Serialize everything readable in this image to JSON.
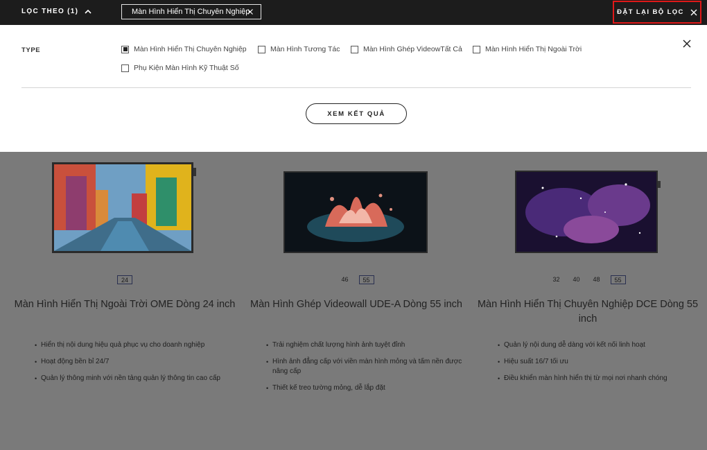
{
  "header": {
    "filter_toggle_label": "LỌC THEO (1)",
    "active_chip_label": "Màn Hình Hiển Thị Chuyên Nghiệp",
    "reset_label": "ĐẶT LẠI BỘ LỌC"
  },
  "filter_panel": {
    "type_label": "TYPE",
    "options": [
      {
        "label": "Màn Hình Hiển Thị Chuyên Nghiệp",
        "checked": true
      },
      {
        "label": "Màn Hình Tương Tác",
        "checked": false
      },
      {
        "label": "Màn Hình Ghép VideowTất Cả",
        "checked": false
      },
      {
        "label": "Màn Hình Hiển Thị Ngoài Trời",
        "checked": false
      },
      {
        "label": "Phụ Kiện Màn Hình Kỹ Thuật Số",
        "checked": false
      }
    ],
    "results_button_label": "XEM KẾT QUẢ"
  },
  "products": [
    {
      "sizes": [
        {
          "label": "24",
          "active": true
        }
      ],
      "title": "Màn Hình Hiển Thị Ngoài Trời OME Dòng 24 inch",
      "features": [
        "Hiển thị nội dung hiệu quả phục vụ cho doanh nghiệp",
        "Hoạt động bền bỉ 24/7",
        "Quản lý thông minh với nền tảng quản lý thông tin cao cấp"
      ]
    },
    {
      "sizes": [
        {
          "label": "46",
          "active": false
        },
        {
          "label": "55",
          "active": true
        }
      ],
      "title": "Màn Hình Ghép Videowall UDE-A Dòng 55 inch",
      "features": [
        "Trải nghiệm chất lượng hình ảnh tuyệt đỉnh",
        "Hình ảnh đẳng cấp với viền màn hình mỏng và tấm nền được nâng cấp",
        "Thiết kế treo tường mỏng, dễ lắp đặt"
      ]
    },
    {
      "sizes": [
        {
          "label": "32",
          "active": false
        },
        {
          "label": "40",
          "active": false
        },
        {
          "label": "48",
          "active": false
        },
        {
          "label": "55",
          "active": true
        }
      ],
      "title": "Màn Hình Hiển Thị Chuyên Nghiệp DCE Dòng 55 inch",
      "features": [
        "Quản lý nội dung dễ dàng với kết nối linh hoạt",
        "Hiệu suất 16/7 tối ưu",
        "Điều khiển màn hình hiển thị từ mọi nơi nhanh chóng"
      ]
    }
  ],
  "colors": {
    "topbar": "#1c1c1c",
    "overlay": "#7a7a7a",
    "reset_highlight": "#e01818",
    "size_active_border": "#2a3050"
  }
}
